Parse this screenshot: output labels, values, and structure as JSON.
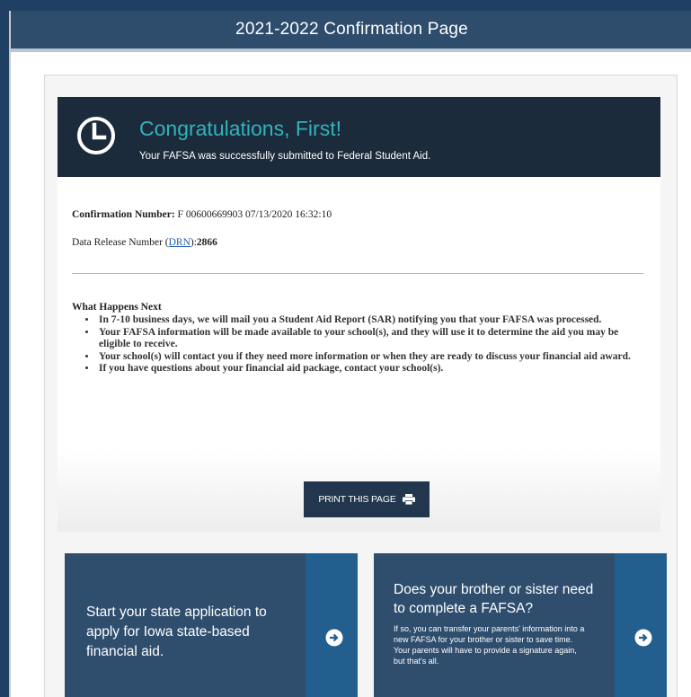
{
  "header": {
    "title": "2021-2022 Confirmation Page"
  },
  "banner": {
    "heading": "Congratulations, First!",
    "subtext": "Your FAFSA was successfully submitted to Federal Student Aid.",
    "icon": "clock-icon",
    "accent_color": "#2fb4bd"
  },
  "confirmation": {
    "label": "Confirmation Number:",
    "value": " F 00600669903 07/13/2020 16:32:10"
  },
  "drn": {
    "prefix": "Data Release Number (",
    "link": "DRN",
    "suffix": "):",
    "value": "2866"
  },
  "next_steps": {
    "title": "What Happens Next",
    "items": [
      "In 7-10 business days, we will mail you a Student Aid Report (SAR) notifying you that your FAFSA was processed.",
      "Your FAFSA information will be made available to your school(s), and they will use it to determine the aid you may be eligible to receive.",
      "Your school(s) will contact you if they need more information or when they are ready to discuss your financial aid award.",
      "If you have questions about your financial aid package, contact your school(s)."
    ]
  },
  "print_button": {
    "label": "PRINT THIS PAGE",
    "icon": "printer-icon"
  },
  "promo_left": {
    "text": "Start your state application to apply for Iowa state-based financial aid.",
    "icon": "arrow-right-circle-icon"
  },
  "promo_right": {
    "heading": "Does your brother or sister need to complete a FAFSA?",
    "body": "If so, you can transfer your parents' information into a new FAFSA for your brother or sister to save time. Your parents will have to provide a signature again, but that's all.",
    "icon": "arrow-right-circle-icon"
  },
  "colors": {
    "page_background": "#1f4063",
    "header_bar": "#2e4d6d",
    "banner_dark": "#1c2b3c",
    "button_dark": "#22364d",
    "promo_card": "#2f4e6e",
    "promo_stripe": "#235f8e",
    "link": "#1f5fb0"
  }
}
